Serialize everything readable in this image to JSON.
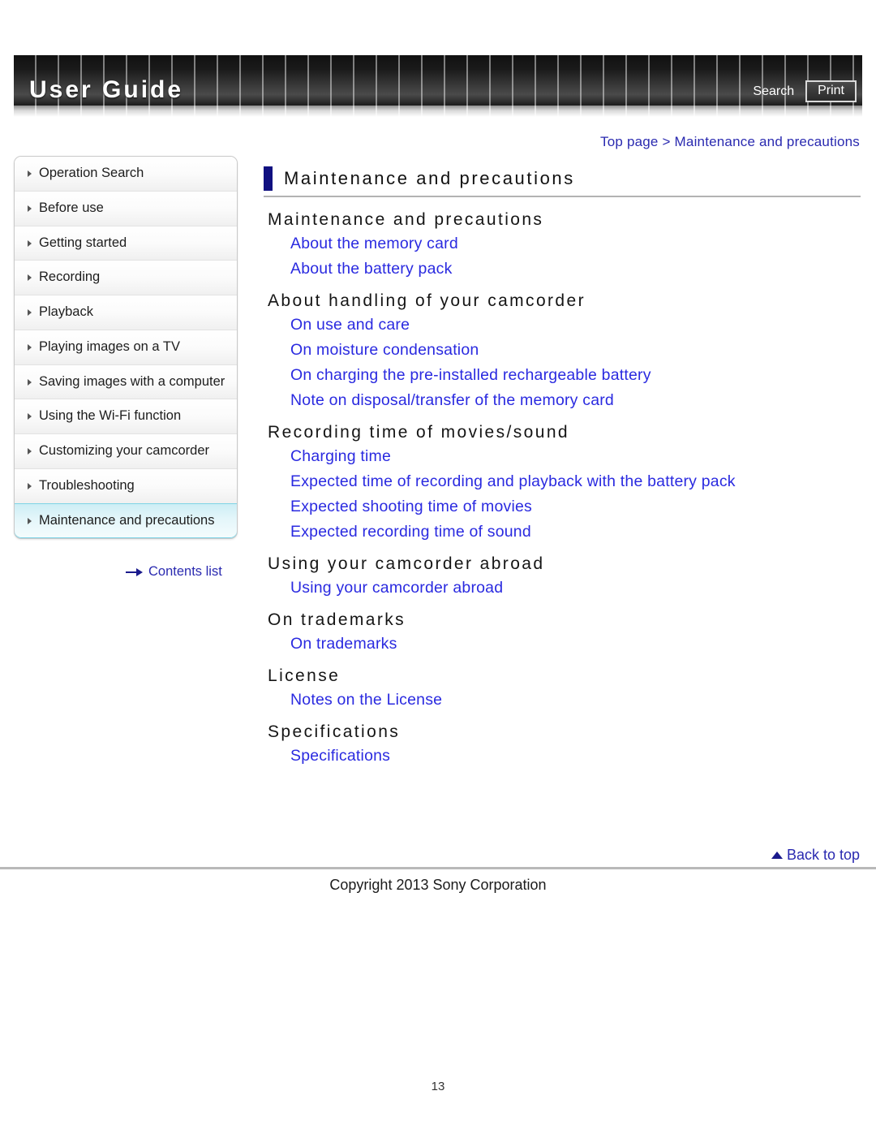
{
  "header": {
    "brand": "User Guide",
    "search_label": "Search",
    "print_label": "Print"
  },
  "breadcrumb": {
    "text": "Top page > Maintenance and precautions"
  },
  "sidebar": {
    "items": [
      {
        "label": "Operation Search",
        "active": false
      },
      {
        "label": "Before use",
        "active": false
      },
      {
        "label": "Getting started",
        "active": false
      },
      {
        "label": "Recording",
        "active": false
      },
      {
        "label": "Playback",
        "active": false
      },
      {
        "label": "Playing images on a TV",
        "active": false
      },
      {
        "label": "Saving images with a computer",
        "active": false
      },
      {
        "label": "Using the Wi-Fi function",
        "active": false
      },
      {
        "label": "Customizing your camcorder",
        "active": false
      },
      {
        "label": "Troubleshooting",
        "active": false
      },
      {
        "label": "Maintenance and precautions",
        "active": true
      }
    ],
    "contents_link": "Contents list"
  },
  "main": {
    "page_title": "Maintenance and precautions",
    "sections": [
      {
        "heading": "Maintenance and precautions",
        "links": [
          "About the memory card",
          "About the battery pack"
        ]
      },
      {
        "heading": "About handling of your camcorder",
        "links": [
          "On use and care",
          "On moisture condensation",
          "On charging the pre-installed rechargeable battery",
          "Note on disposal/transfer of the memory card"
        ]
      },
      {
        "heading": "Recording time of movies/sound",
        "links": [
          "Charging time",
          "Expected time of recording and playback with the battery pack",
          "Expected shooting time of movies",
          "Expected recording time of sound"
        ]
      },
      {
        "heading": "Using your camcorder abroad",
        "links": [
          "Using your camcorder abroad"
        ]
      },
      {
        "heading": "On trademarks",
        "links": [
          "On trademarks"
        ]
      },
      {
        "heading": "License",
        "links": [
          "Notes on the License"
        ]
      },
      {
        "heading": "Specifications",
        "links": [
          "Specifications"
        ]
      }
    ]
  },
  "footer": {
    "back_to_top": "Back to top",
    "copyright": "Copyright 2013 Sony Corporation",
    "page_number": "13"
  },
  "colors": {
    "link_blue": "#2a2ae0",
    "breadcrumb_blue": "#2a2ab0",
    "title_bar_navy": "#101080",
    "active_nav_cyan": "#cdeef5"
  }
}
